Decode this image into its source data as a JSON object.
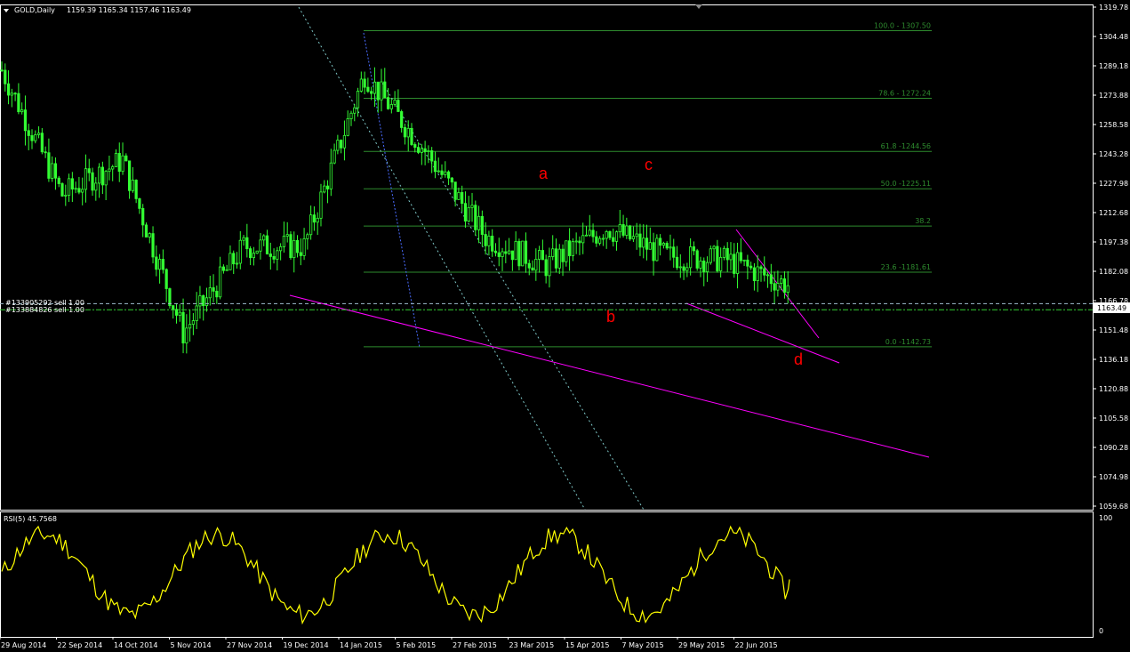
{
  "header": {
    "symbol": "GOLD,Daily",
    "ohlc": "1159.39 1165.34 1157.46 1163.49"
  },
  "orders": [
    "#133905292 sell 1.00",
    "#133884826 sell 1.00"
  ],
  "rsi_label": "RSI(5) 45.7568",
  "rsi_ticks": [
    "100",
    "0"
  ],
  "price_badge": "1163.49",
  "colors": {
    "bull": "#33ff33",
    "fib": "#2e8b2e",
    "trend": "#ff00ff",
    "rsi": "#ffff00",
    "wave": "#ff0000",
    "channel": "#7ec8c8"
  },
  "chart_data": [
    {
      "type": "candlestick",
      "title": "GOLD,Daily",
      "ylim": [
        1059.68,
        1319.78
      ],
      "y_ticks": [
        "1319.78",
        "1304.48",
        "1289.18",
        "1273.88",
        "1258.58",
        "1243.28",
        "1227.98",
        "1212.68",
        "1197.38",
        "1182.08",
        "1166.78",
        "1151.48",
        "1136.18",
        "1120.88",
        "1105.58",
        "1090.28",
        "1074.98",
        "1059.68"
      ],
      "x_ticks": [
        "29 Aug 2014",
        "22 Sep 2014",
        "14 Oct 2014",
        "5 Nov 2014",
        "27 Nov 2014",
        "19 Dec 2014",
        "14 Jan 2015",
        "5 Feb 2015",
        "27 Feb 2015",
        "23 Mar 2015",
        "15 Apr 2015",
        "7 May 2015",
        "29 May 2015",
        "22 Jun 2015"
      ],
      "key_closes": [
        {
          "date": "29 Aug 2014",
          "price": 1287
        },
        {
          "date": "22 Sep 2014",
          "price": 1222
        },
        {
          "date": "14 Oct 2014",
          "price": 1240
        },
        {
          "date": "5 Nov 2014",
          "price": 1150
        },
        {
          "date": "27 Nov 2014",
          "price": 1195
        },
        {
          "date": "19 Dec 2014",
          "price": 1195
        },
        {
          "date": "14 Jan 2015",
          "price": 1285
        },
        {
          "date": "5 Feb 2015",
          "price": 1245
        },
        {
          "date": "27 Feb 2015",
          "price": 1200
        },
        {
          "date": "23 Mar 2015",
          "price": 1185
        },
        {
          "date": "15 Apr 2015",
          "price": 1205
        },
        {
          "date": "7 May 2015",
          "price": 1190
        },
        {
          "date": "29 May 2015",
          "price": 1188
        },
        {
          "date": "22 Jun 2015",
          "price": 1175
        }
      ],
      "last": {
        "open": 1159.39,
        "high": 1165.34,
        "low": 1157.46,
        "close": 1163.49
      },
      "fibonacci": [
        {
          "label": "100.0 - 1307.50",
          "price": 1307.5
        },
        {
          "label": "78.6 - 1272.24",
          "price": 1272.24
        },
        {
          "label": "61.8 -1244.56",
          "price": 1244.56
        },
        {
          "label": "50.0 -1225.11",
          "price": 1225.11
        },
        {
          "label": "38.2",
          "price": 1205.66
        },
        {
          "label": "23.6 -1181.61",
          "price": 1181.61
        },
        {
          "label": "0.0 -1142.73",
          "price": 1142.73
        }
      ],
      "wave_labels": [
        "a",
        "b",
        "c",
        "d"
      ],
      "order_levels": [
        1165.2,
        1162.0
      ]
    },
    {
      "type": "line",
      "title": "RSI(5) 45.7568",
      "ylim": [
        0,
        100
      ],
      "series": [
        {
          "name": "RSI(5)",
          "last": 45.7568
        }
      ]
    }
  ]
}
